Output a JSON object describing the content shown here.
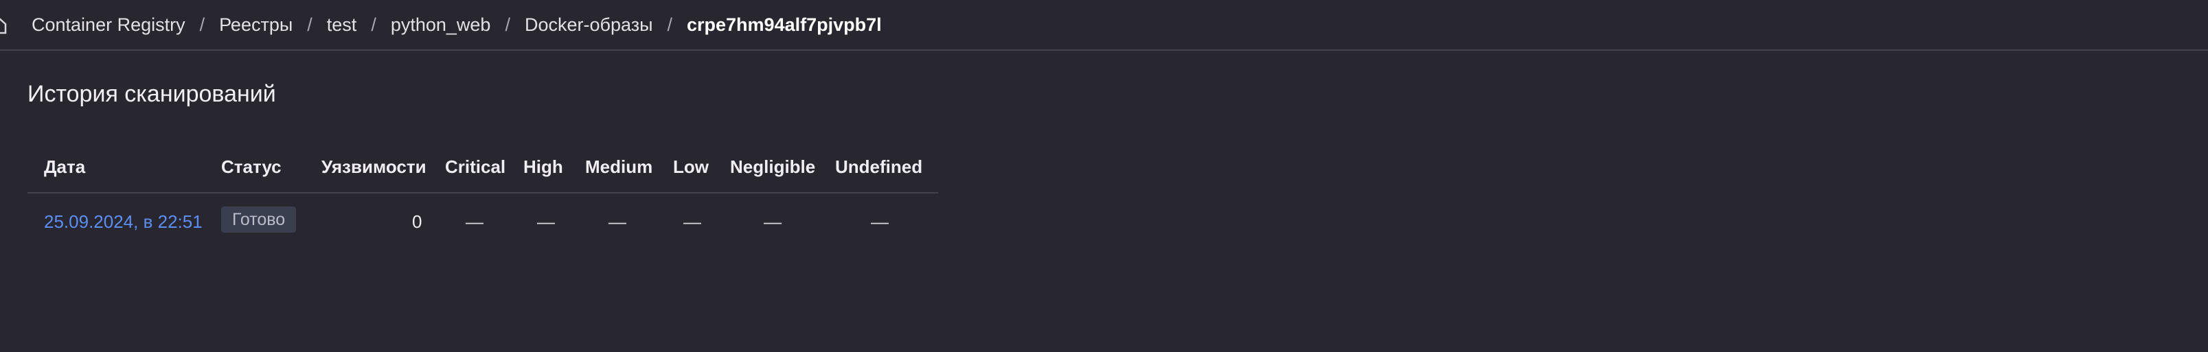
{
  "breadcrumb": {
    "items": [
      "Container Registry",
      "Реестры",
      "test",
      "python_web",
      "Docker-образы"
    ],
    "current": "crpe7hm94alf7pjvpb7l",
    "separator": "/"
  },
  "page": {
    "title": "История сканирований"
  },
  "table": {
    "columns": [
      "Дата",
      "Статус",
      "Уязвимости",
      "Critical",
      "High",
      "Medium",
      "Low",
      "Negligible",
      "Undefined"
    ],
    "rows": [
      {
        "date": "25.09.2024, в 22:51",
        "status": "Готово",
        "vulnerabilities": "0",
        "critical": "—",
        "high": "—",
        "medium": "—",
        "low": "—",
        "negligible": "—",
        "undefined": "—"
      }
    ]
  },
  "colors": {
    "background": "#28262f",
    "link": "#5b8ff5",
    "badge_bg": "#3a3f4f",
    "divider": "#45424d"
  },
  "icons": {
    "home": "home-icon"
  }
}
